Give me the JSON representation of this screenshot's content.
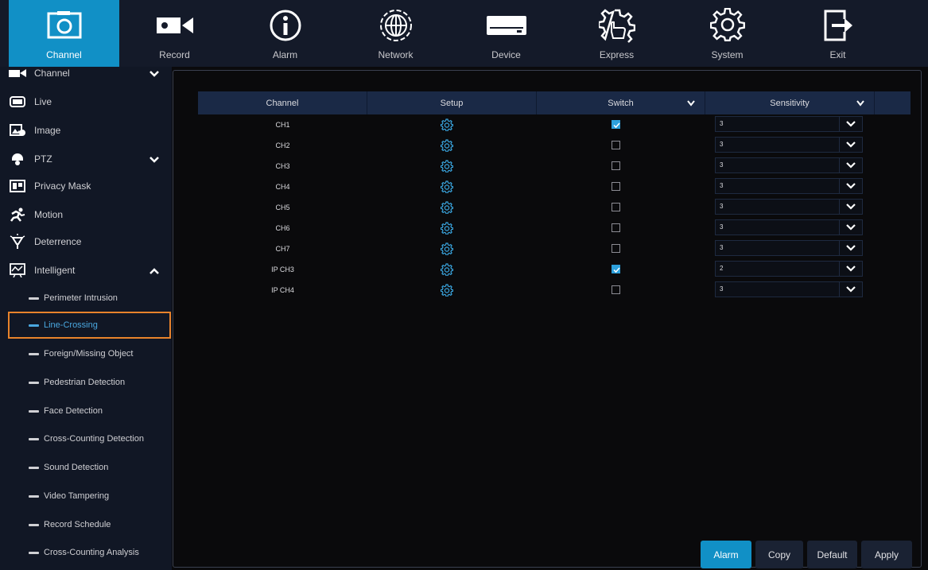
{
  "nav": [
    {
      "label": "Channel",
      "icon": "camera-channel-icon",
      "active": true
    },
    {
      "label": "Record",
      "icon": "video-record-icon"
    },
    {
      "label": "Alarm",
      "icon": "info-alarm-icon"
    },
    {
      "label": "Network",
      "icon": "globe-network-icon"
    },
    {
      "label": "Device",
      "icon": "hard-drive-icon"
    },
    {
      "label": "Express",
      "icon": "gear-hand-icon"
    },
    {
      "label": "System",
      "icon": "gear-icon"
    },
    {
      "label": "Exit",
      "icon": "exit-icon"
    }
  ],
  "sidebar": {
    "items": [
      {
        "label": "Channel",
        "icon": "channel-icon",
        "chevron": "down"
      },
      {
        "label": "Live",
        "icon": "monitor-icon"
      },
      {
        "label": "Image",
        "icon": "image-settings-icon"
      },
      {
        "label": "PTZ",
        "icon": "ptz-dome-icon",
        "chevron": "down"
      },
      {
        "label": "Privacy Mask",
        "icon": "privacy-mask-icon"
      },
      {
        "label": "Motion",
        "icon": "running-person-icon"
      },
      {
        "label": "Deterrence",
        "icon": "light-bulb-icon"
      },
      {
        "label": "Intelligent",
        "icon": "chart-board-icon",
        "chevron": "up"
      }
    ],
    "sub_items": [
      {
        "label": "Perimeter Intrusion"
      },
      {
        "label": "Line-Crossing",
        "active": true
      },
      {
        "label": "Foreign/Missing Object"
      },
      {
        "label": "Pedestrian Detection"
      },
      {
        "label": "Face Detection"
      },
      {
        "label": "Cross-Counting Detection"
      },
      {
        "label": "Sound Detection"
      },
      {
        "label": "Video Tampering"
      },
      {
        "label": "Record Schedule"
      },
      {
        "label": "Cross-Counting Analysis"
      }
    ]
  },
  "table": {
    "headers": {
      "channel": "Channel",
      "setup": "Setup",
      "switch": "Switch",
      "sensitivity": "Sensitivity"
    },
    "rows": [
      {
        "channel": "CH1",
        "switch": true,
        "sensitivity": "3"
      },
      {
        "channel": "CH2",
        "switch": false,
        "sensitivity": "3"
      },
      {
        "channel": "CH3",
        "switch": false,
        "sensitivity": "3"
      },
      {
        "channel": "CH4",
        "switch": false,
        "sensitivity": "3"
      },
      {
        "channel": "CH5",
        "switch": false,
        "sensitivity": "3"
      },
      {
        "channel": "CH6",
        "switch": false,
        "sensitivity": "3"
      },
      {
        "channel": "CH7",
        "switch": false,
        "sensitivity": "3"
      },
      {
        "channel": "IP CH3",
        "switch": true,
        "sensitivity": "2"
      },
      {
        "channel": "IP CH4",
        "switch": false,
        "sensitivity": "3"
      }
    ]
  },
  "buttons": {
    "alarm": "Alarm",
    "copy": "Copy",
    "default": "Default",
    "apply": "Apply"
  },
  "colors": {
    "accent": "#1190c6",
    "highlight_border": "#e8832b",
    "header_bg": "#1a2946"
  }
}
